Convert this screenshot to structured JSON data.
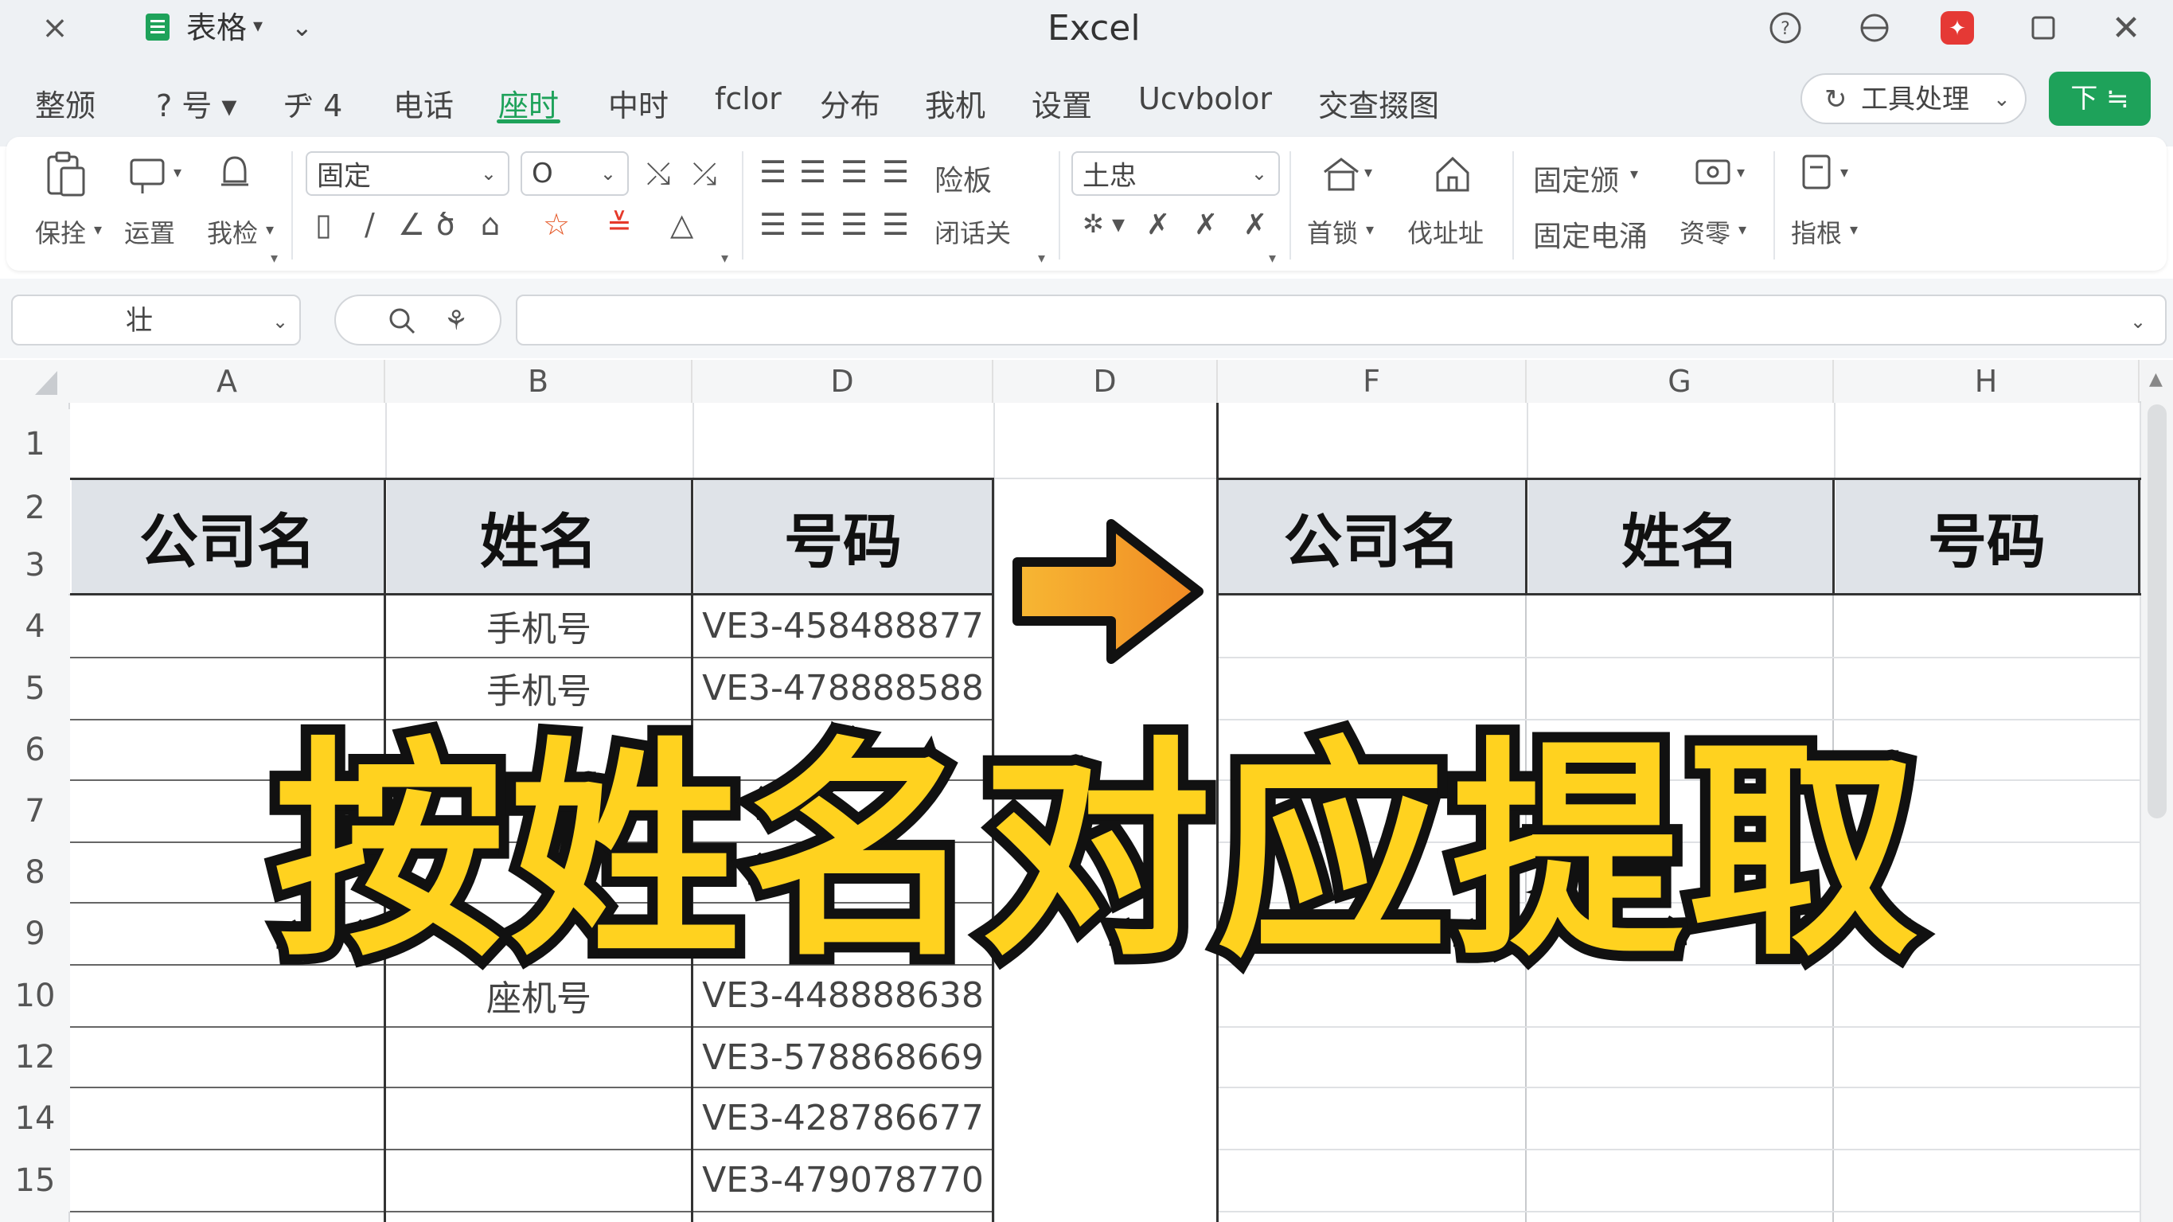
{
  "window": {
    "app_title": "Excel",
    "doc_name": "表格"
  },
  "tabs": [
    {
      "label": "整颁"
    },
    {
      "label": "? 号 ▾"
    },
    {
      "label": "ヂ 4"
    },
    {
      "label": "电话"
    },
    {
      "label": "座时"
    },
    {
      "label": "中时"
    },
    {
      "label": "fclor"
    },
    {
      "label": "分布"
    },
    {
      "label": "我机"
    },
    {
      "label": "设置"
    },
    {
      "label": "Ucvbolor"
    },
    {
      "label": "交查掇图"
    }
  ],
  "toolbar": {
    "tools_dropdown": "工具处理",
    "download_button": "下 ≒"
  },
  "ribbon": {
    "paste_label": "保拴",
    "format_label": "运置",
    "clip_label": "我检",
    "font_name": "固定",
    "font_size": "O",
    "number_format": "土忠",
    "wrap_label": "险板",
    "merge_label": "闭话关",
    "home_label": "首锁",
    "address_label": "伐址址",
    "fixed_label": "固定颁",
    "fixed_phone_label": "固定电涌",
    "cash_label": "资零",
    "hint_label": "指根"
  },
  "formula": {
    "name_box": "壮",
    "content": ""
  },
  "sheet": {
    "columns": [
      "A",
      "B",
      "D",
      "D",
      "F",
      "G",
      "H"
    ],
    "rows": [
      "1",
      "2",
      "3",
      "4",
      "5",
      "6",
      "7",
      "8",
      "9",
      "10",
      "12",
      "14",
      "15"
    ],
    "left_headers": [
      "公司名",
      "姓名",
      "号码"
    ],
    "right_headers": [
      "公司名",
      "姓名",
      "号码"
    ],
    "left_data": [
      {
        "company": "",
        "name": "手机号",
        "number": "VE3-458488877"
      },
      {
        "company": "",
        "name": "手机号",
        "number": "VE3-478888588"
      },
      {
        "company": "",
        "name": "",
        "number": ""
      },
      {
        "company": "",
        "name": "",
        "number": ""
      },
      {
        "company": "",
        "name": "",
        "number": ""
      },
      {
        "company": "",
        "name": "",
        "number": ""
      },
      {
        "company": "",
        "name": "座机号",
        "number": "VE3-448888638"
      },
      {
        "company": "",
        "name": "",
        "number": "VE3-578868669"
      },
      {
        "company": "",
        "name": "",
        "number": "VE3-428786677"
      },
      {
        "company": "",
        "name": "",
        "number": "VE3-479078770"
      }
    ]
  },
  "overlay_title": "按姓名对应提取",
  "colors": {
    "accent_green": "#1ea25a",
    "overlay_yellow": "#ffd21f",
    "arrow_orange": "#f5a623",
    "header_fill": "#dfe3e8"
  },
  "icons": [
    "close-x-icon",
    "sheet-doc-icon",
    "chevron-down-icon",
    "help-icon",
    "cloud-icon",
    "app-badge-icon",
    "maximize-icon",
    "close-icon",
    "search-icon",
    "function-icon",
    "right-arrow-icon"
  ]
}
